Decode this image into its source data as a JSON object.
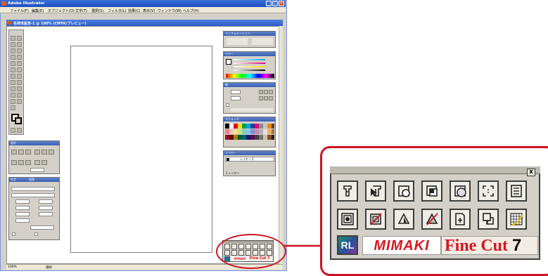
{
  "app": {
    "title": "Adobe Illustrator",
    "menus": [
      "ファイル(F)",
      "編集(E)",
      "オブジェクト(O)",
      "文字(T)",
      "選択(S)",
      "フィルタ(L)",
      "効果(C)",
      "表示(V)",
      "ウィンドウ(W)",
      "ヘルプ(H)"
    ]
  },
  "document": {
    "title": "名称未設定-1 @ 100% (CMYK/プレビュー)"
  },
  "statusbar": {
    "zoom": "100%",
    "status": "選択"
  },
  "panels": {
    "info_tab": "インフォメーション",
    "color_tab": "カラー",
    "stroke_tab": "線",
    "swatch_tab": "スウォッチ",
    "layer_tab": "レイヤー",
    "layer_name": "レイヤー 1",
    "layer_count": "1 レイヤー",
    "transform_tab": "変形",
    "character_tab": "文字",
    "paragraph_tab": "段落"
  },
  "finecut_palette": {
    "close_label": "x",
    "rl_label": "RL",
    "mimaki_logo": "MIMAKI",
    "finecut_logo_fi": "Fi",
    "finecut_logo_ne": "ne Cut",
    "finecut_logo_7": "7",
    "buttons_row1": [
      "plotter-output-icon",
      "cut-output-icon",
      "cut-line-icon",
      "layer-arrange-icon",
      "round-corner-icon",
      "register-mark-icon",
      "list-icon"
    ],
    "buttons_row2": [
      "frame-icon",
      "disable-cut-icon",
      "emboss-icon",
      "remove-cut-icon",
      "add-page-icon",
      "transfer-icon",
      "weed-grid-icon"
    ]
  },
  "colors": {
    "highlight": "#d01222",
    "mimaki_red": "#d8151d",
    "titlebar_blue": "#2a5cc9"
  }
}
